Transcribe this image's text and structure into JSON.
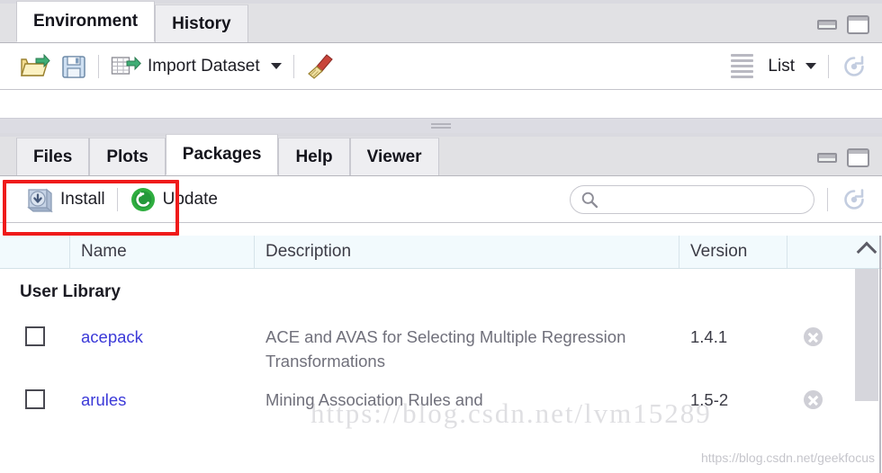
{
  "environment_panel": {
    "tabs": [
      {
        "label": "Environment",
        "active": true
      },
      {
        "label": "History",
        "active": false
      }
    ],
    "window_controls": {
      "minimize": "minimize-window",
      "maximize": "maximize-window"
    },
    "toolbar": {
      "open_icon": "open-folder-icon",
      "save_icon": "save-disk-icon",
      "import_label": "Import Dataset",
      "import_icon": "import-dataset-icon",
      "broom_icon": "clear-objects-broom-icon",
      "view_icon": "list-view-icon",
      "view_label": "List",
      "refresh_icon": "refresh-icon"
    }
  },
  "packages_panel": {
    "tabs": [
      {
        "label": "Files",
        "active": false
      },
      {
        "label": "Plots",
        "active": false
      },
      {
        "label": "Packages",
        "active": true
      },
      {
        "label": "Help",
        "active": false
      },
      {
        "label": "Viewer",
        "active": false
      }
    ],
    "window_controls": {
      "minimize": "minimize-window",
      "maximize": "maximize-window"
    },
    "toolbar": {
      "install_label": "Install",
      "install_icon": "install-package-icon",
      "update_label": "Update",
      "update_icon": "update-package-icon",
      "refresh_icon": "refresh-icon",
      "search_icon": "search-icon",
      "search_value": "",
      "search_placeholder": ""
    },
    "highlight": {
      "target": "install-button",
      "color": "#ef1b1b"
    },
    "table": {
      "columns": [
        "",
        "Name",
        "Description",
        "Version",
        ""
      ],
      "groups": [
        {
          "title": "User Library",
          "rows": [
            {
              "checked": false,
              "name": "acepack",
              "description": "ACE and AVAS for Selecting Multiple Regression Transformations",
              "version": "1.4.1",
              "remove_icon": "remove-package-icon"
            },
            {
              "checked": false,
              "name": "arules",
              "description": "Mining Association Rules and",
              "version": "1.5-2",
              "remove_icon": "remove-package-icon"
            }
          ]
        }
      ]
    },
    "scrollbar": {
      "up_icon": "scroll-up-chevron-icon"
    }
  },
  "watermarks": {
    "large": "https://blog.csdn.net/lvm15289",
    "small": "https://blog.csdn.net/geekfocus"
  },
  "colors": {
    "accent_link": "#3b39d8",
    "highlight": "#ef1b1b",
    "tab_active_bg": "#ffffff",
    "tabbar_bg": "#e1e1e4",
    "table_header_bg": "#f2fafd"
  }
}
